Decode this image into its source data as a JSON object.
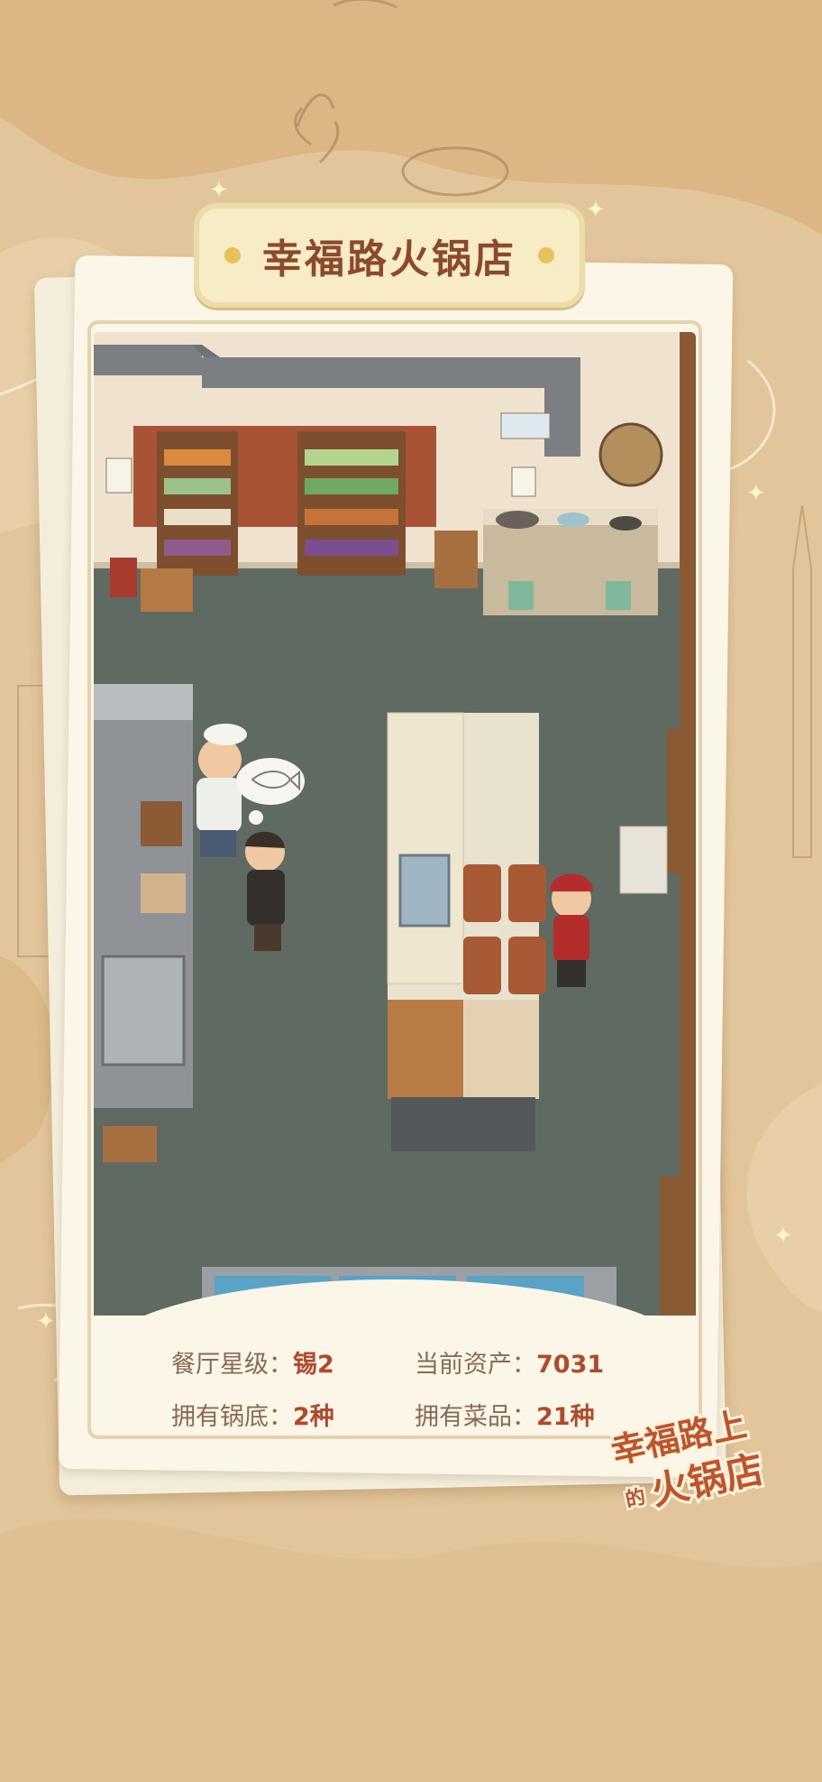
{
  "restaurant": {
    "title": "幸福路火锅店"
  },
  "stats": {
    "star_label": "餐厅星级：",
    "star_value": "锡2",
    "assets_label": "当前资产：",
    "assets_value": "7031",
    "base_label": "拥有锅底：",
    "base_value": "2种",
    "dishes_label": "拥有菜品：",
    "dishes_value": "21种"
  },
  "logo": {
    "line1": "幸福路上",
    "line2_small": "的",
    "line2": "火锅店"
  },
  "colors": {
    "background": "#e2c59a",
    "card": "#fbf6e8",
    "title_text": "#8c4a2c",
    "stat_label": "#8a6a55",
    "stat_value": "#b14a2a",
    "floor": "#5f6a63",
    "wall": "#efe3cf"
  },
  "icons": {
    "thought_bubble": "fish-icon",
    "sparkles": "star-sparkle-icon"
  }
}
